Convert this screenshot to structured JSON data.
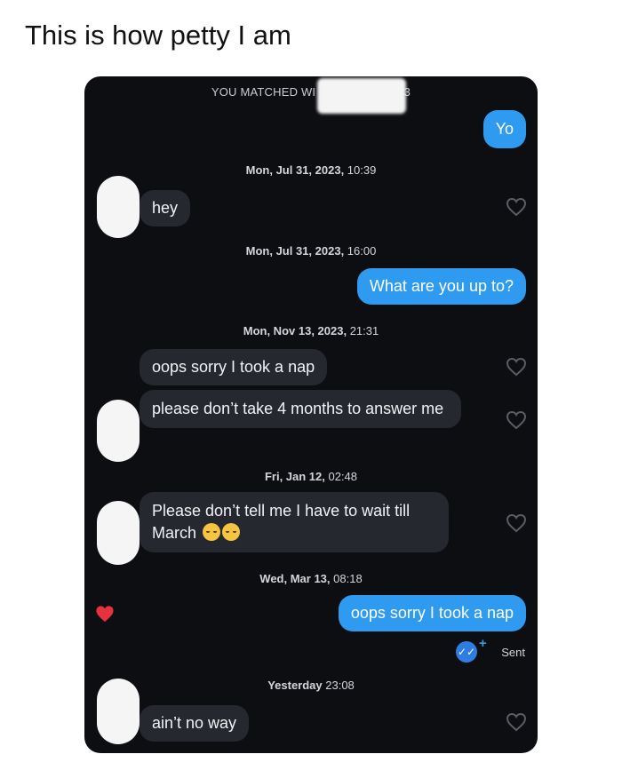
{
  "post": {
    "title": "This is how petty I am"
  },
  "chat": {
    "match_banner_left": "YOU MATCHED WI",
    "match_banner_right": "23",
    "messages": [
      {
        "text": "Yo"
      },
      {
        "timestamp_bold": "Mon, Jul 31, 2023,",
        "timestamp_time": " 10:39"
      },
      {
        "text": "hey"
      },
      {
        "timestamp_bold": "Mon, Jul 31, 2023,",
        "timestamp_time": " 16:00"
      },
      {
        "text": "What are you up to?"
      },
      {
        "timestamp_bold": "Mon, Nov 13, 2023,",
        "timestamp_time": " 21:31"
      },
      {
        "text": "oops sorry I took a nap"
      },
      {
        "text": "please don’t take 4 months to answer me"
      },
      {
        "timestamp_bold": "Fri, Jan 12,",
        "timestamp_time": " 02:48"
      },
      {
        "text": "Please don’t tell me I have to wait till March"
      },
      {
        "timestamp_bold": "Wed, Mar 13,",
        "timestamp_time": " 08:18"
      },
      {
        "text": "oops sorry I took a nap"
      },
      {
        "status": "Sent"
      },
      {
        "timestamp_bold": "Yesterday",
        "timestamp_time": " 23:08"
      },
      {
        "text": "ain’t no way"
      }
    ]
  },
  "icons": {
    "heart_outline": "heart-outline-icon",
    "heart_liked": "heart-filled-icon",
    "read_receipt": "double-check-icon",
    "emoji": "loudly-crying-face-emoji"
  },
  "colors": {
    "screen_bg": "#0d0e12",
    "received_bubble": "#262830",
    "sent_bubble": "#2f9bf0",
    "liked_heart": "#e5323e"
  }
}
